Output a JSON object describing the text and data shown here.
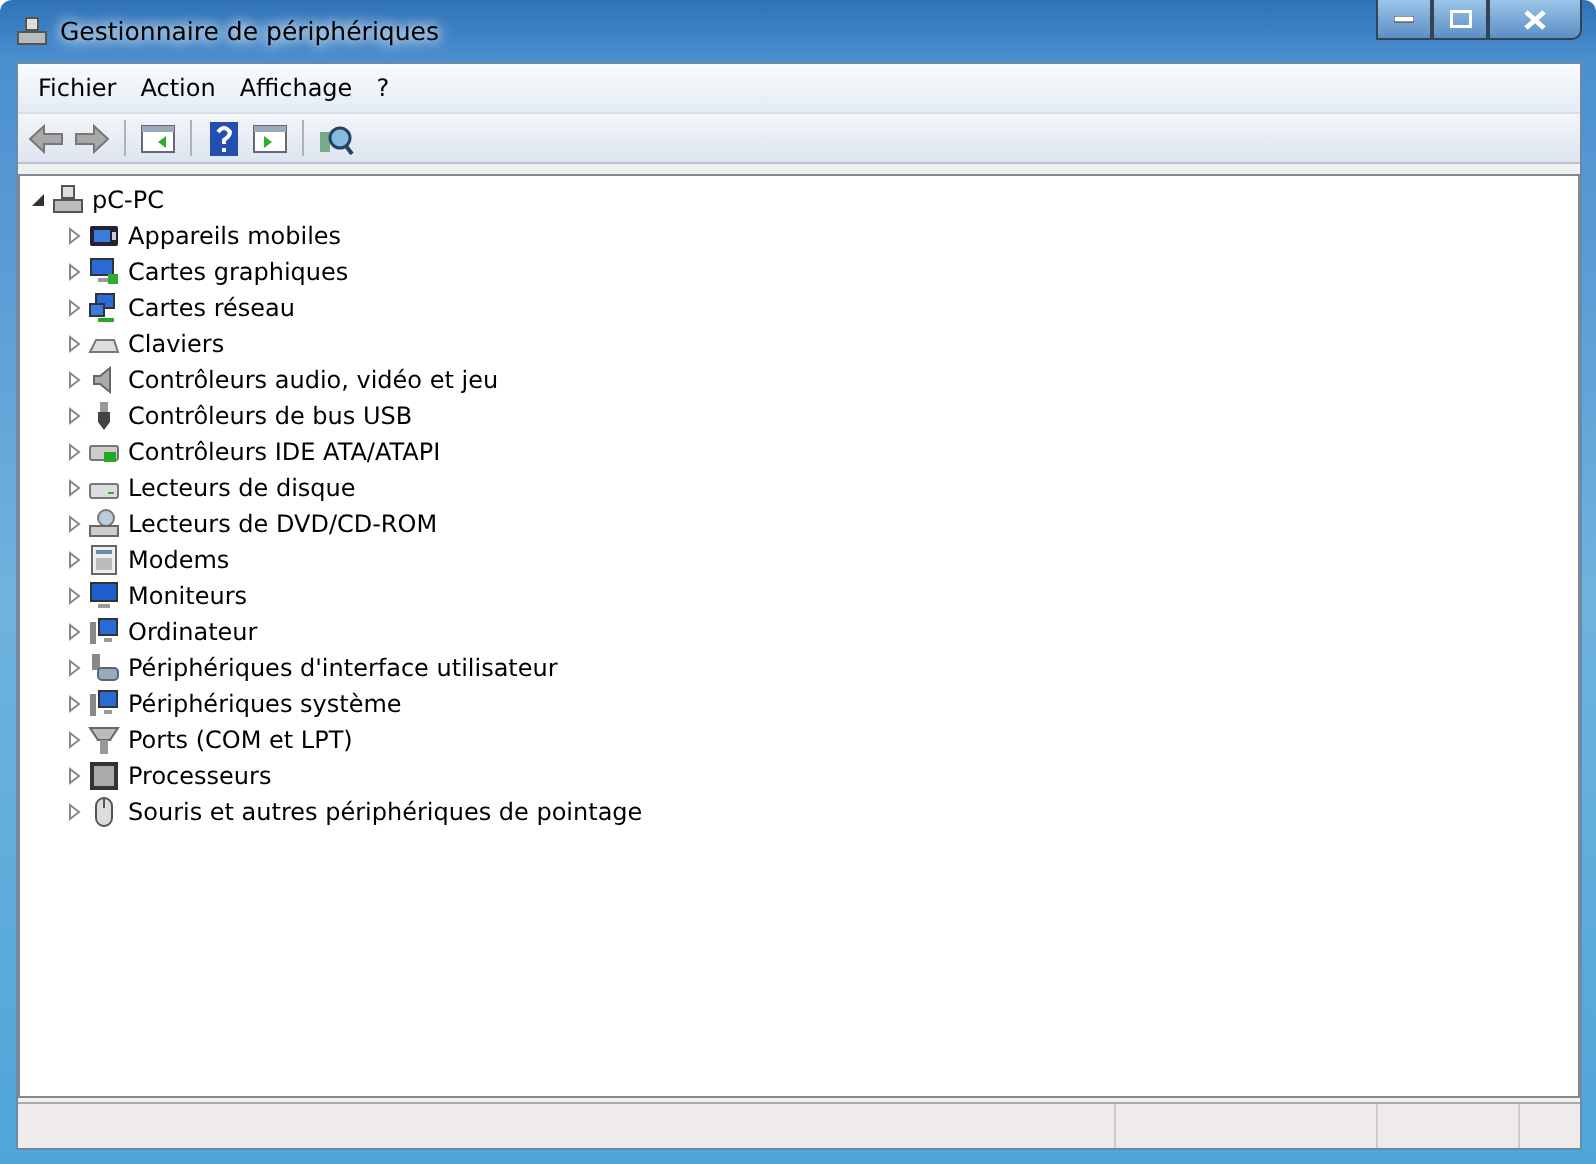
{
  "window": {
    "title": "Gestionnaire de périphériques"
  },
  "menu": [
    "Fichier",
    "Action",
    "Affichage",
    "?"
  ],
  "toolbar": [
    {
      "kind": "back",
      "disabled": true
    },
    {
      "kind": "forward",
      "disabled": true
    },
    {
      "kind": "separator"
    },
    {
      "kind": "tree",
      "disabled": false
    },
    {
      "kind": "separator"
    },
    {
      "kind": "help",
      "disabled": false
    },
    {
      "kind": "pane",
      "disabled": false
    },
    {
      "kind": "separator"
    },
    {
      "kind": "scan",
      "disabled": false
    }
  ],
  "tree": {
    "label": "pC-PC",
    "expanded": true,
    "children": [
      {
        "label": "Appareils mobiles",
        "expanded": false
      },
      {
        "label": "Cartes graphiques",
        "expanded": false
      },
      {
        "label": "Cartes réseau",
        "expanded": false
      },
      {
        "label": "Claviers",
        "expanded": false
      },
      {
        "label": "Contrôleurs audio, vidéo et jeu",
        "expanded": false
      },
      {
        "label": "Contrôleurs de bus USB",
        "expanded": false
      },
      {
        "label": "Contrôleurs IDE ATA/ATAPI",
        "expanded": false
      },
      {
        "label": "Lecteurs de disque",
        "expanded": false
      },
      {
        "label": "Lecteurs de DVD/CD-ROM",
        "expanded": false
      },
      {
        "label": "Modems",
        "expanded": false
      },
      {
        "label": "Moniteurs",
        "expanded": false
      },
      {
        "label": "Ordinateur",
        "expanded": false
      },
      {
        "label": "Périphériques d'interface utilisateur",
        "expanded": false
      },
      {
        "label": "Périphériques système",
        "expanded": false
      },
      {
        "label": "Ports (COM et LPT)",
        "expanded": false
      },
      {
        "label": "Processeurs",
        "expanded": false
      },
      {
        "label": "Souris et autres périphériques de pointage",
        "expanded": false
      }
    ]
  }
}
